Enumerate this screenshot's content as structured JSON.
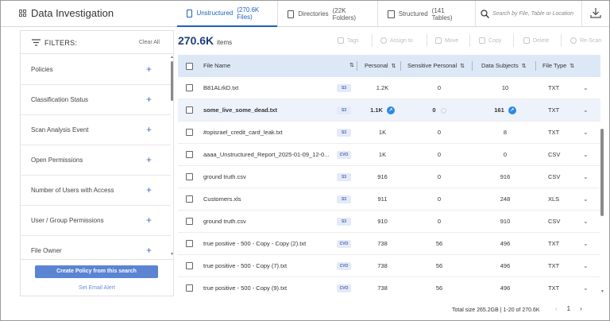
{
  "app": {
    "title": "Data Investigation"
  },
  "tabs": [
    {
      "label": "Unstructured",
      "count": "(270.6K Files)"
    },
    {
      "label": "Directories",
      "count": "(22K Folders)"
    },
    {
      "label": "Structured",
      "count": "(141 Tables)"
    }
  ],
  "search": {
    "placeholder": "Search by File, Table or Location"
  },
  "filters": {
    "title": "FILTERS:",
    "clear_label": "Clear All",
    "items": [
      "Policies",
      "Classification Status",
      "Scan Analysis Event",
      "Open Permissions",
      "Number of Users with Access",
      "User / Group Permissions",
      "File Owner"
    ],
    "create_policy_label": "Create Policy from this search",
    "email_alert_label": "Set Email Alert"
  },
  "results": {
    "count": "270.6K",
    "unit": "items"
  },
  "actions": [
    "Tags",
    "Assign to",
    "Move",
    "Copy",
    "Delete",
    "Re-Scan"
  ],
  "table": {
    "columns": [
      "File Name",
      "Personal",
      "Sensitive Personal",
      "Data Subjects",
      "File Type"
    ],
    "rows": [
      {
        "name": "B81ALrkD.txt",
        "source": "S3",
        "personal": "1.2K",
        "sensitive": "0",
        "subjects": "10",
        "type": "TXT"
      },
      {
        "name": "some_live_some_dead.txt",
        "source": "S3",
        "personal": "1.1K",
        "sensitive": "0",
        "subjects": "161",
        "type": "TXT"
      },
      {
        "name": "#opisrael_credit_card_leak.txt",
        "source": "S3",
        "personal": "1K",
        "sensitive": "0",
        "subjects": "8",
        "type": "TXT"
      },
      {
        "name": "aaaa_Unstructured_Report_2025-01-09_12-0...",
        "source": "CVO",
        "personal": "1K",
        "sensitive": "0",
        "subjects": "0",
        "type": "CSV"
      },
      {
        "name": "ground truth.csv",
        "source": "S3",
        "personal": "916",
        "sensitive": "0",
        "subjects": "916",
        "type": "CSV"
      },
      {
        "name": "Customers.xls",
        "source": "S3",
        "personal": "911",
        "sensitive": "0",
        "subjects": "248",
        "type": "XLS"
      },
      {
        "name": "ground truth.csv",
        "source": "S3",
        "personal": "910",
        "sensitive": "0",
        "subjects": "910",
        "type": "CSV"
      },
      {
        "name": "true positive - 500 - Copy - Copy (2).txt",
        "source": "CVO",
        "personal": "738",
        "sensitive": "56",
        "subjects": "496",
        "type": "TXT"
      },
      {
        "name": "true positive - 500 - Copy (7).txt",
        "source": "CVO",
        "personal": "738",
        "sensitive": "56",
        "subjects": "496",
        "type": "TXT"
      },
      {
        "name": "true positive - 500 - Copy (9).txt",
        "source": "CVO",
        "personal": "738",
        "sensitive": "56",
        "subjects": "496",
        "type": "TXT"
      }
    ]
  },
  "footer": {
    "total_size": "Total size 265.2GB",
    "range": "1-20 of 270.6K",
    "page": "1"
  },
  "colors": {
    "accent": "#1f5fbf",
    "header_bg": "#dde8f7",
    "button": "#5b84d3"
  }
}
